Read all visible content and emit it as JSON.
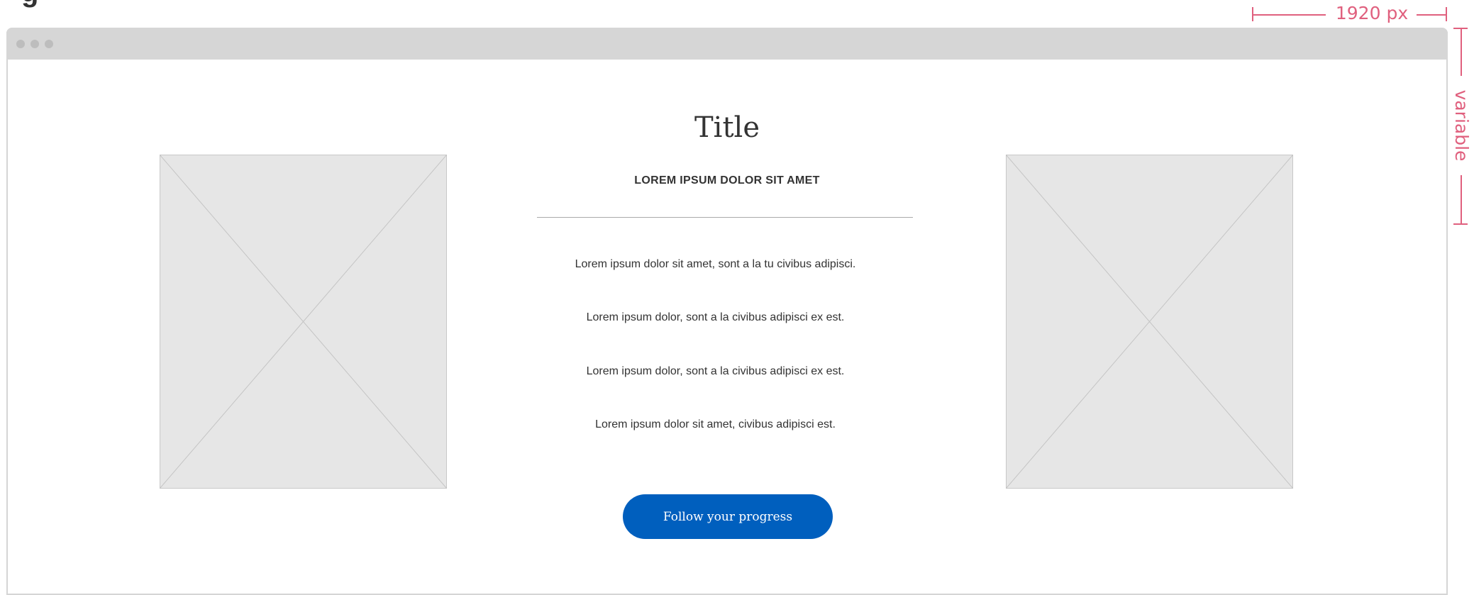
{
  "annotation": {
    "width_label": "1920 px",
    "height_label": "variable",
    "color": "#e0607e"
  },
  "main": {
    "title": "Title",
    "subtitle": "LOREM IPSUM DOLOR SIT AMET",
    "lines": [
      "Lorem ipsum dolor sit amet, sont a la tu civibus adipisci.",
      "Lorem ipsum dolor, sont a la civibus adipisci ex est.",
      "Lorem ipsum dolor, sont a la civibus adipisci ex est.",
      "Lorem ipsum dolor sit amet, civibus adipisci est."
    ],
    "button_label": "Follow your progress",
    "button_color": "#005fbe"
  },
  "icons": {
    "window_controls": "window-dot-icon",
    "image_placeholder": "image-placeholder-icon"
  }
}
